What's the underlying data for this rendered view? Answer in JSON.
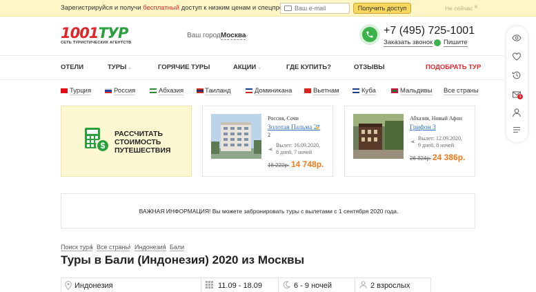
{
  "promo": {
    "text_before": "Зарегистрируйся и получи ",
    "text_highlight": "бесплатный",
    "text_after": " доступ к низким ценам и спецпредложениям",
    "email_placeholder": "Ваш e-mail",
    "get_access_label": "Получить доступ",
    "not_now_label": "Не сейчас",
    "close_symbol": "×",
    "highlight_color": "#e3282b"
  },
  "header": {
    "logo_text": "1001",
    "logo_text_accent": "ТУР",
    "logo_tagline": "Сеть туристических агентств",
    "city_label": "Ваш город:",
    "city_value": "Москва",
    "phone": "+7 (495) 725-1001",
    "callback_label": "Заказать звонок",
    "write_label": "Пишите",
    "brand_red": "#e0252b",
    "brand_green": "#2aa03c"
  },
  "nav": {
    "items": [
      {
        "label": "ОТЕЛИ"
      },
      {
        "label": "ТУРЫ"
      },
      {
        "label": "ГОРЯЧИЕ ТУРЫ"
      },
      {
        "label": "АКЦИИ"
      },
      {
        "label": "ГДЕ КУПИТЬ?"
      },
      {
        "label": "ОТЗЫВЫ"
      },
      {
        "label": "ПОДОБРАТЬ ТУР"
      }
    ]
  },
  "countries": [
    {
      "label": "Турция"
    },
    {
      "label": "Россия"
    },
    {
      "label": "Абхазия"
    },
    {
      "label": "Таиланд"
    },
    {
      "label": "Доминикана"
    },
    {
      "label": "Вьетнам"
    },
    {
      "label": "Куба"
    },
    {
      "label": "Мальдивы"
    },
    {
      "label": "Все страны"
    }
  ],
  "calc_card": {
    "line1": "РАССЧИТАТЬ",
    "line2": "СТОИМОСТЬ",
    "line3": "ПУТЕШЕСТВИЯ"
  },
  "tours": [
    {
      "location": "Россия, Сочи",
      "hotel": "Золотая Пальма 2*",
      "stars": "2",
      "departure": "Вылет: 16.09.2020,",
      "duration": "8 дней, 7 ночей",
      "old_price": "16 222р.",
      "new_price": "14 748р."
    },
    {
      "location": "Абхазия, Новый Афон",
      "hotel": "Грифон 3",
      "stars": "",
      "departure": "Вылет: 12.09.2020,",
      "duration": "9 дней, 8 ночей",
      "old_price": "26 824р.",
      "new_price": "24 386р."
    }
  ],
  "info": {
    "text": "ВАЖНАЯ ИНФОРМАЦИЯ! Вы можете забронировать туры с вылетами с 1 сентября 2020 года."
  },
  "breadcrumb": [
    {
      "label": "Поиск тура"
    },
    {
      "label": "Все страны"
    },
    {
      "label": "Индонезия"
    },
    {
      "label": "Бали"
    }
  ],
  "breadcrumb_sep": "\\",
  "page_title": "Туры в Бали (Индонезия) 2020 из Москвы",
  "search": {
    "destination": "Индонезия",
    "dates": "11.09 - 18.09",
    "nights": "6 - 9 ночей",
    "guests": "2 взрослых"
  },
  "sidebar": {
    "cart_badge": "1"
  }
}
